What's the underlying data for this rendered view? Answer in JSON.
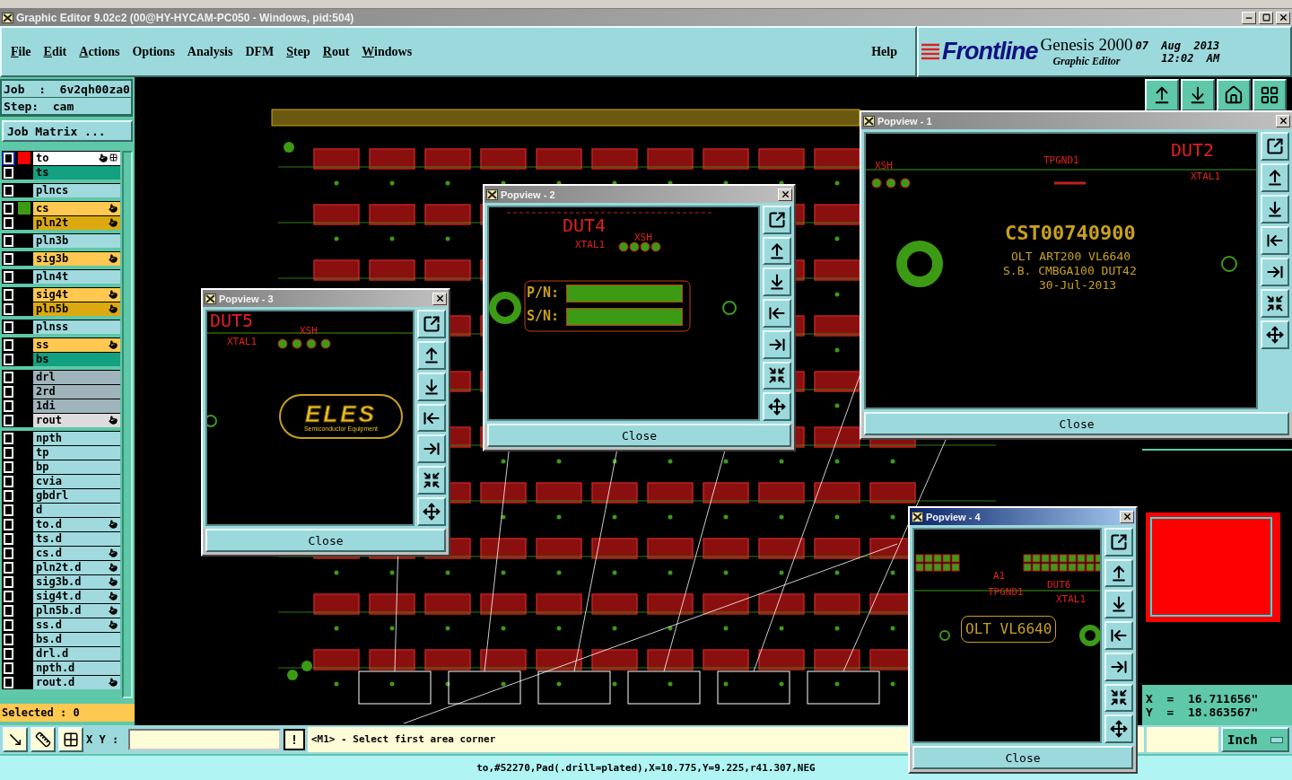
{
  "window": {
    "title": "Graphic Editor 9.02c2 (00@HY-HYCAM-PC050 - Windows, pid:504)"
  },
  "menu": {
    "items": [
      {
        "label": "File",
        "mnemonic": true
      },
      {
        "label": "Edit",
        "mnemonic": true
      },
      {
        "label": "Actions",
        "mnemonic": true
      },
      {
        "label": "Options",
        "mnemonic": false
      },
      {
        "label": "Analysis",
        "mnemonic": false
      },
      {
        "label": "DFM",
        "mnemonic": false
      },
      {
        "label": "Step",
        "mnemonic": true
      },
      {
        "label": "Rout",
        "mnemonic": true
      },
      {
        "label": "Windows",
        "mnemonic": true
      }
    ],
    "help": "Help"
  },
  "brand": {
    "logo": "Frontline",
    "product": "Genesis 2000",
    "subtitle": "Graphic Editor",
    "date": "07  Aug  2013",
    "time": "12:02  AM"
  },
  "job": {
    "job": "Job  :  6v2qh00za0",
    "step": "Step:  cam",
    "matrix_button": "Job Matrix ..."
  },
  "layer_groups": [
    {
      "layers": [
        {
          "name": "to",
          "color": "#ffffff",
          "active": true,
          "affected": true,
          "swatch": {
            "color": "#ff0000"
          }
        },
        {
          "name": "ts",
          "color": "#12a080",
          "active": false,
          "affected": false
        }
      ]
    },
    {
      "layers": [
        {
          "name": "plncs",
          "color": "#a0dade",
          "active": false,
          "affected": false
        }
      ]
    },
    {
      "layers": [
        {
          "name": "cs",
          "color": "#ffc850",
          "active": false,
          "affected": true,
          "swatch": {
            "color": "#3c9a14"
          }
        },
        {
          "name": "pln2t",
          "color": "#dcaa10",
          "active": false,
          "affected": true
        }
      ]
    },
    {
      "layers": [
        {
          "name": "pln3b",
          "color": "#a0dade",
          "active": false,
          "affected": false
        }
      ]
    },
    {
      "layers": [
        {
          "name": "sig3b",
          "color": "#ffc850",
          "active": false,
          "affected": true
        }
      ]
    },
    {
      "layers": [
        {
          "name": "pln4t",
          "color": "#a0dade",
          "active": false,
          "affected": false
        }
      ]
    },
    {
      "layers": [
        {
          "name": "sig4t",
          "color": "#ffc850",
          "active": false,
          "affected": true
        },
        {
          "name": "pln5b",
          "color": "#dcaa10",
          "active": false,
          "affected": true
        }
      ]
    },
    {
      "layers": [
        {
          "name": "plnss",
          "color": "#a0dade",
          "active": false,
          "affected": false
        }
      ]
    },
    {
      "layers": [
        {
          "name": "ss",
          "color": "#ffc850",
          "active": false,
          "affected": true
        },
        {
          "name": "bs",
          "color": "#12a080",
          "active": false,
          "affected": false
        }
      ]
    },
    {
      "layers": [
        {
          "name": "drl",
          "color": "#a0b4bc",
          "active": false,
          "affected": false
        },
        {
          "name": "2rd",
          "color": "#a0b4bc",
          "active": false,
          "affected": false
        },
        {
          "name": "1di",
          "color": "#a0b4bc",
          "active": false,
          "affected": false
        },
        {
          "name": "rout",
          "color": "#dcdcdc",
          "active": false,
          "affected": true
        }
      ]
    },
    {
      "layers": [
        {
          "name": "npth",
          "color": "#a0dade",
          "active": false,
          "affected": false
        },
        {
          "name": "tp",
          "color": "#a0dade",
          "active": false,
          "affected": false
        },
        {
          "name": "bp",
          "color": "#a0dade",
          "active": false,
          "affected": false
        },
        {
          "name": "cvia",
          "color": "#a0dade",
          "active": false,
          "affected": false
        },
        {
          "name": "gbdrl",
          "color": "#a0dade",
          "active": false,
          "affected": false
        },
        {
          "name": "d",
          "color": "#a0dade",
          "active": false,
          "affected": false
        },
        {
          "name": "to.d",
          "color": "#a0dade",
          "active": false,
          "affected": true
        },
        {
          "name": "ts.d",
          "color": "#a0dade",
          "active": false,
          "affected": false
        },
        {
          "name": "cs.d",
          "color": "#a0dade",
          "active": false,
          "affected": true
        },
        {
          "name": "pln2t.d",
          "color": "#a0dade",
          "active": false,
          "affected": true
        },
        {
          "name": "sig3b.d",
          "color": "#a0dade",
          "active": false,
          "affected": true
        },
        {
          "name": "sig4t.d",
          "color": "#a0dade",
          "active": false,
          "affected": true
        },
        {
          "name": "pln5b.d",
          "color": "#a0dade",
          "active": false,
          "affected": true
        },
        {
          "name": "ss.d",
          "color": "#a0dade",
          "active": false,
          "affected": true
        },
        {
          "name": "bs.d",
          "color": "#a0dade",
          "active": false,
          "affected": false
        },
        {
          "name": "drl.d",
          "color": "#a0dade",
          "active": false,
          "affected": false
        },
        {
          "name": "npth.d",
          "color": "#a0dade",
          "active": false,
          "affected": false
        },
        {
          "name": "rout.d",
          "color": "#a0dade",
          "active": false,
          "affected": true
        }
      ]
    }
  ],
  "selected": "Selected : 0",
  "popviews": [
    {
      "title": "Popview - 1",
      "active": false,
      "close": "Close",
      "labels": [
        {
          "kind": "ref",
          "text": "XSH"
        },
        {
          "kind": "ref",
          "text": "TPGND1"
        },
        {
          "kind": "title",
          "text": "DUT2"
        },
        {
          "kind": "ref",
          "text": "XTAL1"
        },
        {
          "kind": "part_number",
          "text": "CST00740900"
        },
        {
          "kind": "marking",
          "text": "OLT ART200 VL6640"
        },
        {
          "kind": "marking",
          "text": "S.B. CMBGA100 DUT42"
        },
        {
          "kind": "marking",
          "text": "30-Jul-2013"
        }
      ]
    },
    {
      "title": "Popview - 2",
      "active": false,
      "close": "Close",
      "labels": [
        {
          "kind": "title",
          "text": "DUT4"
        },
        {
          "kind": "ref",
          "text": "XTAL1"
        },
        {
          "kind": "ref",
          "text": "XSH"
        },
        {
          "kind": "field",
          "text": "P/N:"
        },
        {
          "kind": "field",
          "text": "S/N:"
        }
      ]
    },
    {
      "title": "Popview - 3",
      "active": false,
      "close": "Close",
      "labels": [
        {
          "kind": "title",
          "text": "DUT5"
        },
        {
          "kind": "ref",
          "text": "XSH"
        },
        {
          "kind": "ref",
          "text": "XTAL1"
        },
        {
          "kind": "logo",
          "text": "ELES",
          "tagline": "Semiconductor Equipment"
        }
      ]
    },
    {
      "title": "Popview - 4",
      "active": true,
      "close": "Close",
      "labels": [
        {
          "kind": "ref",
          "text": "A1"
        },
        {
          "kind": "ref",
          "text": "DUT6"
        },
        {
          "kind": "ref",
          "text": "TPGND1"
        },
        {
          "kind": "ref",
          "text": "XTAL1"
        },
        {
          "kind": "marking_box",
          "text": "OLT VL6640"
        }
      ]
    }
  ],
  "coordinates": {
    "x": "X  =  16.711656\"",
    "y": "Y  =  18.863567\""
  },
  "units": "Inch",
  "command": {
    "xy_label": "X Y :",
    "alert": "!",
    "message": "<M1> - Select first area corner"
  },
  "status_bar": "to,#52270,Pad(.drill=plated),X=10.775,Y=9.225,r41.307,NEG"
}
